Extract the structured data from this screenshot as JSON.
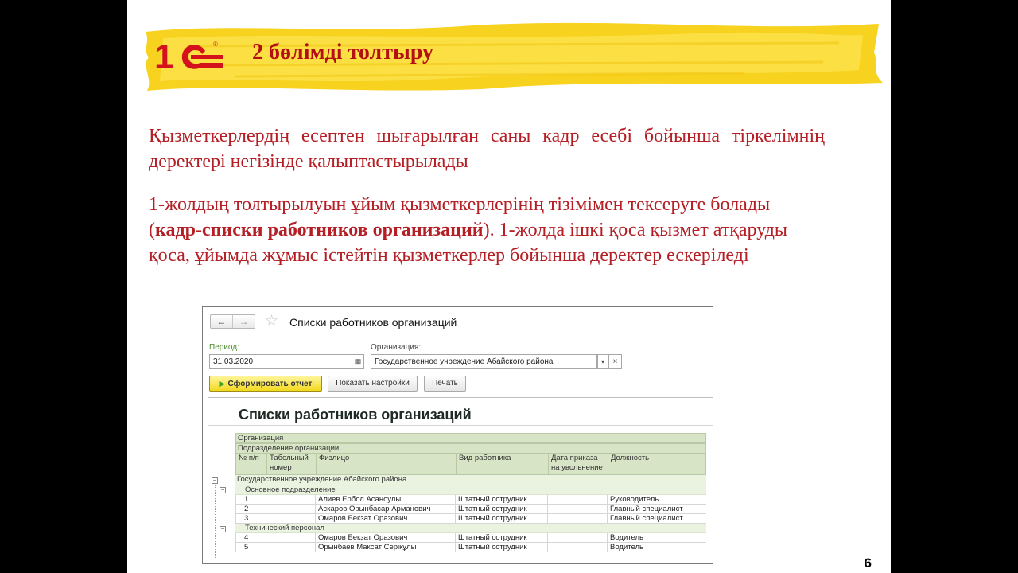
{
  "slide": {
    "title": "2 бөлімді толтыру",
    "paragraph1": "Қызметкерлердің есептен шығарылған саны кадр есебі бойынша тіркелімнің деректері негізінде қалыптастырылады",
    "paragraph2_a": "1-жолдың толтырылуын ұйым қызметкерлерінің тізімімен тексеруге болады (",
    "paragraph2_bold": "кадр-списки работников организаций",
    "paragraph2_b": "). 1-жолда ішкі қоса қызмет атқаруды қоса, ұйымда жұмыс істейтін қызметкерлер бойынша деректер ескеріледі",
    "page_number": "6",
    "logo_text": "1С",
    "colors": {
      "title": "#b40f12",
      "text": "#b41e24",
      "banner": "#f7d21e"
    }
  },
  "window": {
    "nav_back": "←",
    "nav_forward": "→",
    "star_icon": "☆",
    "title": "Списки работников организаций",
    "period_label": "Период:",
    "period_value": "31.03.2020",
    "org_label": "Организация:",
    "org_value": "Государственное учреждение Абайского района",
    "drop_icon": "▾",
    "clear_icon": "×",
    "calendar_icon": "▦",
    "btn_run": "Сформировать отчет",
    "btn_settings": "Показать настройки",
    "btn_print": "Печать",
    "report_title": "Списки работников организаций"
  },
  "report": {
    "header_org": "Организация",
    "header_dept": "Подразделение организации",
    "columns": [
      "№ п/п",
      "Табельный номер",
      "Физлицо",
      "Вид работника",
      "Дата приказа на увольнение",
      "Должность"
    ],
    "org_group": "Государственное учреждение Абайского района",
    "departments": [
      {
        "name": "Основное подразделение",
        "rows": [
          {
            "n": "1",
            "tab": "",
            "person": "Алиев Ербол Асаноулы",
            "kind": "Штатный сотрудник",
            "date": "",
            "position": "Руководитель"
          },
          {
            "n": "2",
            "tab": "",
            "person": "Аскаров Орынбасар Арманович",
            "kind": "Штатный сотрудник",
            "date": "",
            "position": "Главный специалист"
          },
          {
            "n": "3",
            "tab": "",
            "person": "Омаров Бекзат Оразович",
            "kind": "Штатный сотрудник",
            "date": "",
            "position": "Главный специалист"
          }
        ]
      },
      {
        "name": "Технический персонал",
        "rows": [
          {
            "n": "4",
            "tab": "",
            "person": "Омаров Бекзат Оразович",
            "kind": "Штатный сотрудник",
            "date": "",
            "position": "Водитель"
          },
          {
            "n": "5",
            "tab": "",
            "person": "Орынбаев Максат Серікұлы",
            "kind": "Штатный сотрудник",
            "date": "",
            "position": "Водитель"
          }
        ]
      }
    ]
  }
}
